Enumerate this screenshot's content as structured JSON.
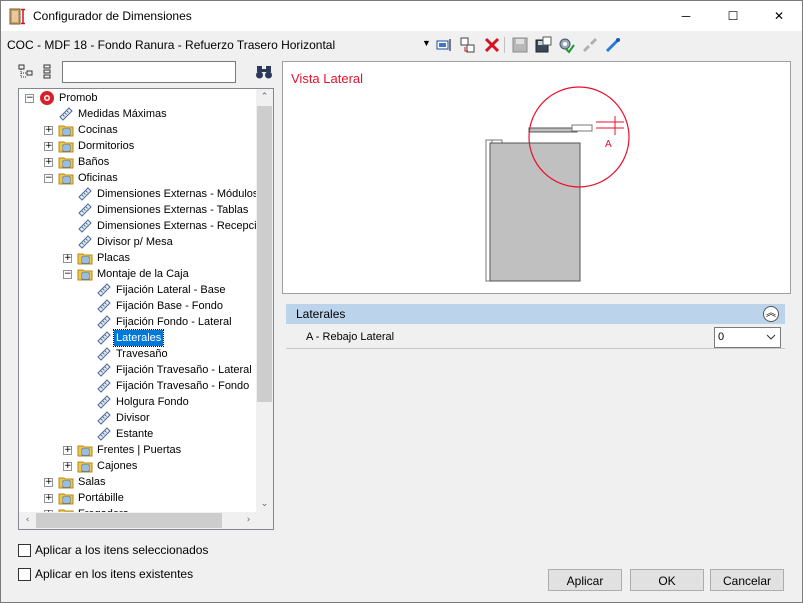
{
  "window": {
    "title": "Configurador de Dimensiones",
    "minimize_symbol": "─",
    "maximize_symbol": "☐",
    "close_symbol": "✕"
  },
  "toolbar": {
    "combo_value": "COC - MDF 18 - Fondo Ranura - Refuerzo Trasero Horizontal",
    "icons": [
      "insert-icon",
      "move-icon",
      "delete-icon",
      "save-icon",
      "save-as-icon",
      "settings-icon",
      "disconnect-icon",
      "connect-icon"
    ]
  },
  "tree_tools": {
    "search_value": ""
  },
  "tree": {
    "items": [
      {
        "label": "Promob",
        "level": 0,
        "expand": "−",
        "icon": "promob"
      },
      {
        "label": "Medidas Máximas",
        "level": 1,
        "expand": "",
        "icon": "measure"
      },
      {
        "label": "Cocinas",
        "level": 1,
        "expand": "+",
        "icon": "folder"
      },
      {
        "label": "Dormitorios",
        "level": 1,
        "expand": "+",
        "icon": "folder"
      },
      {
        "label": "Baños",
        "level": 1,
        "expand": "+",
        "icon": "folder"
      },
      {
        "label": "Oficinas",
        "level": 1,
        "expand": "−",
        "icon": "folder"
      },
      {
        "label": "Dimensiones Externas - Módulos",
        "level": 2,
        "expand": "",
        "icon": "measure"
      },
      {
        "label": "Dimensiones Externas - Tablas",
        "level": 2,
        "expand": "",
        "icon": "measure"
      },
      {
        "label": "Dimensiones Externas - Recepción",
        "level": 2,
        "expand": "",
        "icon": "measure"
      },
      {
        "label": "Divisor p/ Mesa",
        "level": 2,
        "expand": "",
        "icon": "measure"
      },
      {
        "label": "Placas",
        "level": 2,
        "expand": "+",
        "icon": "folder"
      },
      {
        "label": "Montaje de la Caja",
        "level": 2,
        "expand": "−",
        "icon": "folder"
      },
      {
        "label": "Fijación Lateral - Base",
        "level": 3,
        "expand": "",
        "icon": "measure"
      },
      {
        "label": " Fijación Base - Fondo",
        "level": 3,
        "expand": "",
        "icon": "measure"
      },
      {
        "label": "Fijación Fondo - Lateral",
        "level": 3,
        "expand": "",
        "icon": "measure"
      },
      {
        "label": "Laterales",
        "level": 3,
        "expand": "",
        "icon": "measure",
        "selected": true
      },
      {
        "label": "Travesaño",
        "level": 3,
        "expand": "",
        "icon": "measure"
      },
      {
        "label": "Fijación Travesaño - Lateral",
        "level": 3,
        "expand": "",
        "icon": "measure"
      },
      {
        "label": "Fijación Travesaño - Fondo",
        "level": 3,
        "expand": "",
        "icon": "measure"
      },
      {
        "label": "Holgura Fondo",
        "level": 3,
        "expand": "",
        "icon": "measure"
      },
      {
        "label": "Divisor",
        "level": 3,
        "expand": "",
        "icon": "measure"
      },
      {
        "label": "Estante",
        "level": 3,
        "expand": "",
        "icon": "measure"
      },
      {
        "label": "Frentes | Puertas",
        "level": 2,
        "expand": "+",
        "icon": "folder"
      },
      {
        "label": "Cajones",
        "level": 2,
        "expand": "+",
        "icon": "folder"
      },
      {
        "label": "Salas",
        "level": 1,
        "expand": "+",
        "icon": "folder"
      },
      {
        "label": "Portábille",
        "level": 1,
        "expand": "+",
        "icon": "folder"
      },
      {
        "label": "Fregadero",
        "level": 1,
        "expand": "+",
        "icon": "folder"
      }
    ]
  },
  "preview": {
    "title": "Vista Lateral",
    "marker_label": "A",
    "accent_color": "#e8102b"
  },
  "properties": {
    "group_label": "Laterales",
    "collapse_symbol": "︽",
    "row_label": "A - Rebajo Lateral",
    "row_value": "0"
  },
  "options": {
    "apply_selected_label": "Aplicar a los itens seleccionados",
    "apply_existing_label": "Aplicar en los itens existentes"
  },
  "buttons": {
    "apply": "Aplicar",
    "ok": "OK",
    "cancel": "Cancelar"
  }
}
